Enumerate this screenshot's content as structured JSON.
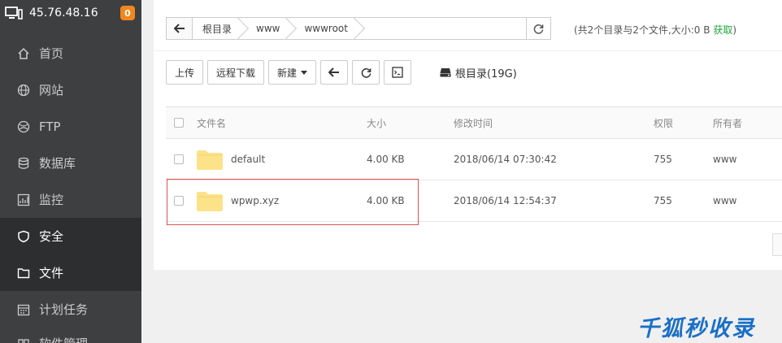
{
  "server": {
    "ip": "45.76.48.16",
    "badge": "0"
  },
  "nav": [
    {
      "label": "首页",
      "icon": "home-icon"
    },
    {
      "label": "网站",
      "icon": "globe-icon"
    },
    {
      "label": "FTP",
      "icon": "ftp-icon"
    },
    {
      "label": "数据库",
      "icon": "database-icon"
    },
    {
      "label": "监控",
      "icon": "monitor-icon"
    },
    {
      "label": "安全",
      "icon": "shield-icon"
    },
    {
      "label": "文件",
      "icon": "folder-icon"
    },
    {
      "label": "计划任务",
      "icon": "calendar-icon"
    },
    {
      "label": "软件管理",
      "icon": "apps-icon"
    }
  ],
  "path": {
    "crumbs": [
      "根目录",
      "www",
      "wwwroot"
    ]
  },
  "summary": {
    "text": "(共2个目录与2个文件,大小:0 B ",
    "link": "获取",
    "close": ")"
  },
  "toolbar": {
    "upload": "上传",
    "remote_download": "远程下载",
    "new": "新建",
    "disk": "根目录(19G)"
  },
  "table": {
    "headers": {
      "name": "文件名",
      "size": "大小",
      "mtime": "修改时间",
      "perm": "权限",
      "owner": "所有者"
    },
    "rows": [
      {
        "name": "default",
        "size": "4.00 KB",
        "mtime": "2018/06/14 07:30:42",
        "perm": "755",
        "owner": "www"
      },
      {
        "name": "wpwp.xyz",
        "size": "4.00 KB",
        "mtime": "2018/06/14 12:54:37",
        "perm": "755",
        "owner": "www"
      }
    ]
  },
  "watermark": "千狐秒收录",
  "colors": {
    "accent": "#20a53a",
    "sidebar": "#3d3f41",
    "badge": "#f0861d",
    "highlight": "#d9534f",
    "folder": "#fce38a"
  }
}
